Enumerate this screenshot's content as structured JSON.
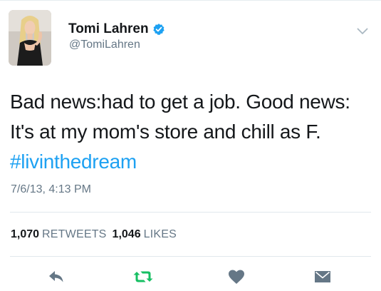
{
  "user": {
    "display_name": "Tomi Lahren",
    "handle": "@TomiLahren",
    "verified_icon": "verified-badge-icon"
  },
  "tweet": {
    "text_lines": [
      "Bad news:had to get a job. Good news:",
      "It's at my mom's store and chill as F."
    ],
    "hashtag": "#livinthedream",
    "timestamp": "7/6/13, 4:13 PM"
  },
  "stats": {
    "retweets_count": "1,070",
    "retweets_label": "RETWEETS",
    "likes_count": "1,046",
    "likes_label": "LIKES"
  },
  "actions": {
    "reply_icon": "reply-icon",
    "retweet_icon": "retweet-icon",
    "like_icon": "heart-icon",
    "dm_icon": "direct-message-icon"
  },
  "colors": {
    "accent": "#1da1f2",
    "retweet_green": "#17bf63",
    "icon_gray": "#657786",
    "text": "#14171a",
    "verified_blue": "#1da1f2"
  }
}
